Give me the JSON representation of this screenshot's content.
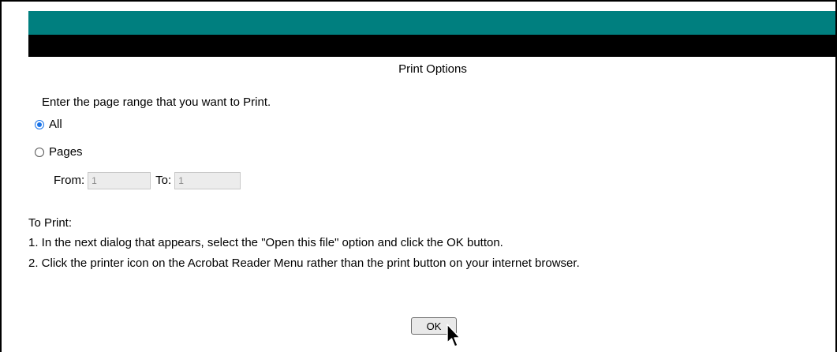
{
  "header": {
    "title": "Print Options"
  },
  "range": {
    "prompt": "Enter the page range that you want to Print.",
    "option_all_label": "All",
    "option_pages_label": "Pages",
    "selected": "All",
    "from_label": "From:",
    "from_value": "1",
    "to_label": "To:",
    "to_value": "1"
  },
  "instructions": {
    "heading": "To Print:",
    "steps": [
      "1. In the next dialog that appears, select the \"Open this file\" option and click the OK button.",
      "2. Click the printer icon on the Acrobat Reader Menu rather than the print button on your internet browser."
    ]
  },
  "actions": {
    "ok_label": "OK"
  },
  "colors": {
    "header_bar": "#007f7f",
    "subheader_bar": "#000000",
    "radio_selected": "#1a73e8"
  },
  "cursor": {
    "icon": "arrow-cursor-icon"
  }
}
